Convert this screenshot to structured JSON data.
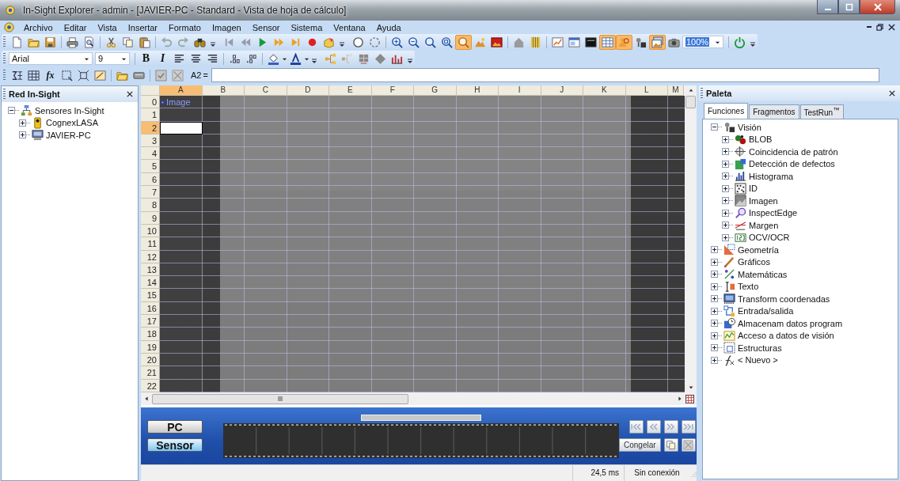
{
  "window": {
    "title": "In-Sight Explorer - admin - [JAVIER-PC - Standard - Vista de hoja de cálculo]"
  },
  "menu": [
    "Archivo",
    "Editar",
    "Vista",
    "Insertar",
    "Formato",
    "Imagen",
    "Sensor",
    "Sistema",
    "Ventana",
    "Ayuda"
  ],
  "toolbar": {
    "buttons": [
      {
        "on": false
      },
      {
        "on": false
      },
      {
        "on": false
      },
      {
        "on": false
      },
      {
        "on": false
      },
      {
        "on": false
      },
      {
        "on": false
      },
      {
        "on": false
      },
      {
        "on": false
      },
      {
        "on": false
      },
      {
        "on": false
      },
      {
        "on": false
      },
      {
        "on": false
      },
      {
        "on": false
      },
      {
        "on": false
      },
      {
        "on": false
      },
      {
        "on": false
      },
      {
        "on": false
      },
      {
        "on": false
      },
      {
        "on": false
      },
      {
        "on": false
      },
      {
        "on": false
      },
      {
        "on": false
      },
      {
        "on": false
      },
      {
        "on": true
      },
      {
        "on": false
      },
      {
        "on": false
      },
      {
        "on": false
      },
      {
        "on": false
      },
      {
        "on": false
      },
      {
        "on": false
      },
      {
        "on": false
      },
      {
        "on": true
      },
      {
        "on": true
      },
      {
        "on": false
      },
      {
        "on": true
      },
      {
        "on": false
      },
      {
        "on": false
      }
    ],
    "zoom": "100%"
  },
  "format_bar": {
    "font": "Arial",
    "size": "9",
    "styles": [
      {
        "label": "B",
        "on": false
      },
      {
        "label": "I",
        "on": false
      }
    ]
  },
  "formula_bar": {
    "function_button": "fx",
    "cell_ref": "A2",
    "equals": "="
  },
  "network_panel": {
    "title": "Red In-Sight",
    "tree": [
      {
        "label": "Sensores In-Sight",
        "expanded": true,
        "children": [
          {
            "label": "CognexLASA",
            "expanded": false
          },
          {
            "label": "JAVIER-PC",
            "expanded": false
          }
        ]
      }
    ]
  },
  "sheet": {
    "columns": [
      {
        "label": "A",
        "selected": true
      },
      {
        "label": "B",
        "selected": false
      },
      {
        "label": "C",
        "selected": false
      },
      {
        "label": "D",
        "selected": false
      },
      {
        "label": "E",
        "selected": false
      },
      {
        "label": "F",
        "selected": false
      },
      {
        "label": "G",
        "selected": false
      },
      {
        "label": "H",
        "selected": false
      },
      {
        "label": "I",
        "selected": false
      },
      {
        "label": "J",
        "selected": false
      },
      {
        "label": "K",
        "selected": false
      },
      {
        "label": "L",
        "selected": false
      },
      {
        "label": "M",
        "selected": false
      }
    ],
    "rows": [
      {
        "label": "0",
        "selected": false,
        "cell_a": "Image"
      },
      {
        "label": "1",
        "selected": false
      },
      {
        "label": "2",
        "selected": true
      },
      {
        "label": "3",
        "selected": false
      },
      {
        "label": "4",
        "selected": false
      },
      {
        "label": "5",
        "selected": false
      },
      {
        "label": "6",
        "selected": false
      },
      {
        "label": "7",
        "selected": false
      },
      {
        "label": "8",
        "selected": false
      },
      {
        "label": "9",
        "selected": false
      },
      {
        "label": "10",
        "selected": false
      },
      {
        "label": "11",
        "selected": false
      },
      {
        "label": "12",
        "selected": false
      },
      {
        "label": "13",
        "selected": false
      },
      {
        "label": "14",
        "selected": false
      },
      {
        "label": "15",
        "selected": false
      },
      {
        "label": "16",
        "selected": false
      },
      {
        "label": "17",
        "selected": false
      },
      {
        "label": "18",
        "selected": false
      },
      {
        "label": "19",
        "selected": false
      },
      {
        "label": "20",
        "selected": false
      },
      {
        "label": "21",
        "selected": false
      },
      {
        "label": "22",
        "selected": false
      }
    ]
  },
  "filmstrip_panel": {
    "sources": [
      {
        "label": "PC",
        "selected": false
      },
      {
        "label": "Sensor",
        "selected": true
      }
    ],
    "freeze_button": "Congelar"
  },
  "status_bar": [
    "24,5 ms",
    "Sin conexión"
  ],
  "palette": {
    "title": "Paleta",
    "tabs": [
      {
        "label": "Funciones",
        "selected": true
      },
      {
        "label": "Fragmentos",
        "selected": false
      },
      {
        "label": "TestRun$^{™}$",
        "selected": false
      }
    ],
    "tree": [
      {
        "label": "Visión",
        "expanded": true,
        "children": [
          {
            "label": "BLOB",
            "expanded": false
          },
          {
            "label": "Coincidencia de patrón",
            "expanded": false
          },
          {
            "label": "Detección de defectos",
            "expanded": false
          },
          {
            "label": "Histograma",
            "expanded": false
          },
          {
            "label": "ID",
            "expanded": false
          },
          {
            "label": "Imagen",
            "expanded": false
          },
          {
            "label": "InspectEdge",
            "expanded": false
          },
          {
            "label": "Margen",
            "expanded": false
          },
          {
            "label": "OCV/OCR",
            "expanded": false
          }
        ]
      },
      {
        "label": "Geometría",
        "expanded": false
      },
      {
        "label": "Gráficos",
        "expanded": false
      },
      {
        "label": "Matemáticas",
        "expanded": false
      },
      {
        "label": "Texto",
        "expanded": false
      },
      {
        "label": "Transform coordenadas",
        "expanded": false
      },
      {
        "label": "Entrada/salida",
        "expanded": false
      },
      {
        "label": "Almacenam datos program",
        "expanded": false
      },
      {
        "label": "Acceso a datos de visión",
        "expanded": false
      },
      {
        "label": "Estructuras",
        "expanded": false
      },
      {
        "label": "< Nuevo >",
        "expanded": false
      }
    ]
  }
}
